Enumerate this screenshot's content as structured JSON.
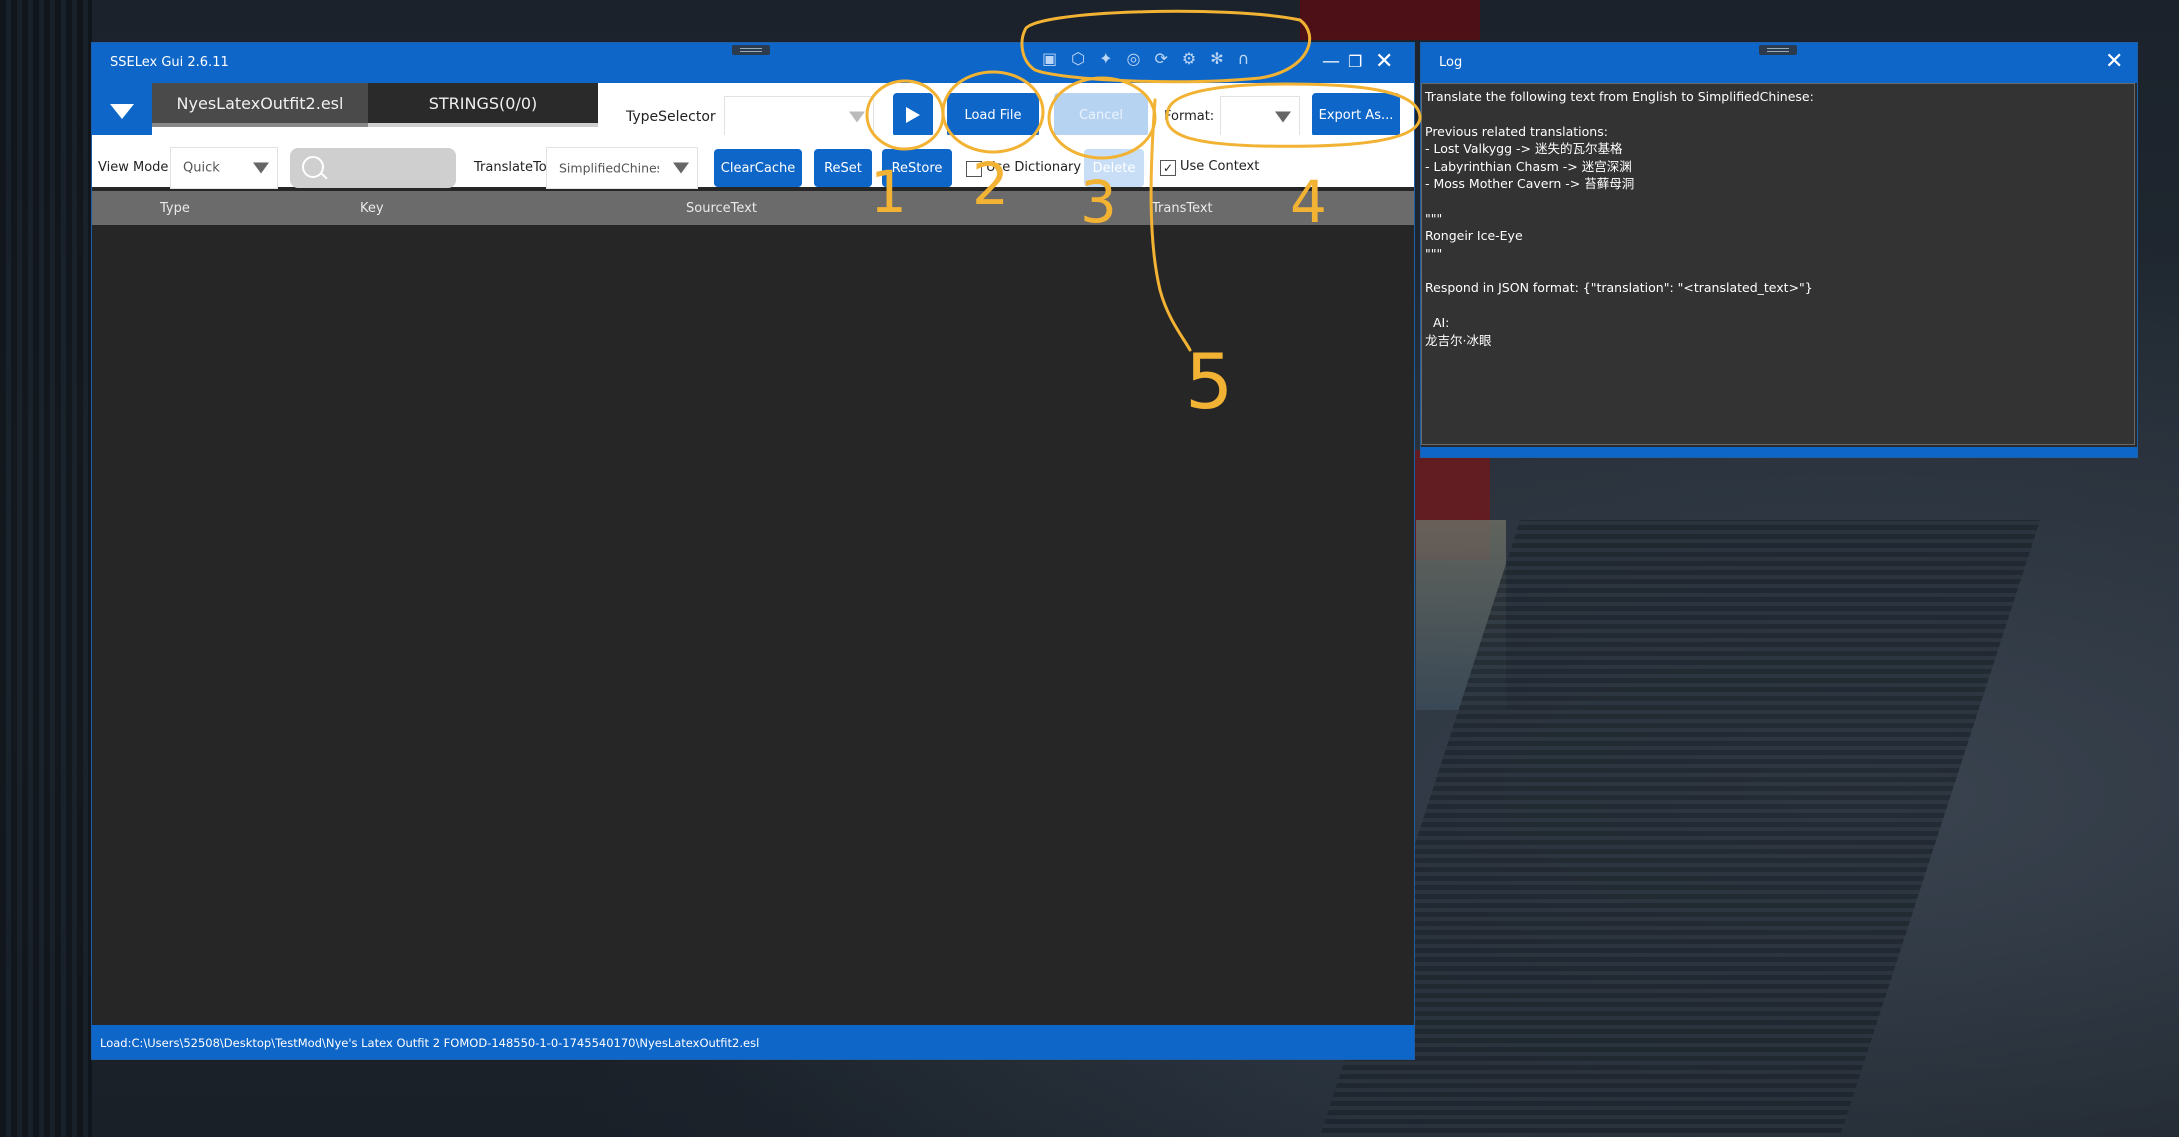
{
  "main_window": {
    "title": "SSELex Gui 2.6.11",
    "tabs": [
      {
        "label": "NyesLatexOutfit2.esl"
      },
      {
        "label": "STRINGS(0/0)"
      }
    ],
    "toolbar": {
      "type_selector_label": "TypeSelector",
      "type_selector_value": "",
      "load_file_label": "Load File",
      "cancel_label": "Cancel",
      "format_label": "Format:",
      "format_value": "",
      "export_label": "Export As..."
    },
    "toolbar2": {
      "view_mode_label": "View Mode",
      "view_mode_value": "Quick",
      "search_placeholder": "",
      "translate_to_label": "TranslateTo",
      "translate_to_value": "SimplifiedChinese",
      "clear_cache_label": "ClearCache",
      "reset_label": "ReSet",
      "restore_label": "ReStore",
      "use_dictionary_label": "Use Dictionary",
      "use_dictionary_checked": false,
      "delete_label": "Delete",
      "use_context_label": "Use Context",
      "use_context_checked": true
    },
    "grid_columns": [
      "Type",
      "Key",
      "SourceText",
      "TransText"
    ],
    "status_text": "Load:C:\\Users\\52508\\Desktop\\TestMod\\Nye's Latex Outfit 2 FOMOD-148550-1-0-1745540170\\NyesLatexOutfit2.esl"
  },
  "log_window": {
    "title": "Log",
    "lines": [
      "Translate the following text from English to SimplifiedChinese:",
      "",
      "Previous related translations:",
      "- Lost Valkygg -> 迷失的瓦尔基格",
      "- Labyrinthian Chasm -> 迷宫深渊",
      "- Moss Mother Cavern -> 苔藓母洞",
      "",
      "\"\"\"",
      "Rongeir Ice-Eye",
      "\"\"\"",
      "",
      "Respond in JSON format: {\"translation\": \"<translated_text>\"}",
      "",
      "  AI:",
      "龙吉尔·冰眼"
    ]
  },
  "annotations": [
    "1",
    "2",
    "3",
    "4",
    "5"
  ],
  "colors": {
    "accent": "#0e66c8",
    "annotation": "#f2b233",
    "panel_dark": "#262626",
    "grid_header": "#6b6b6b"
  }
}
